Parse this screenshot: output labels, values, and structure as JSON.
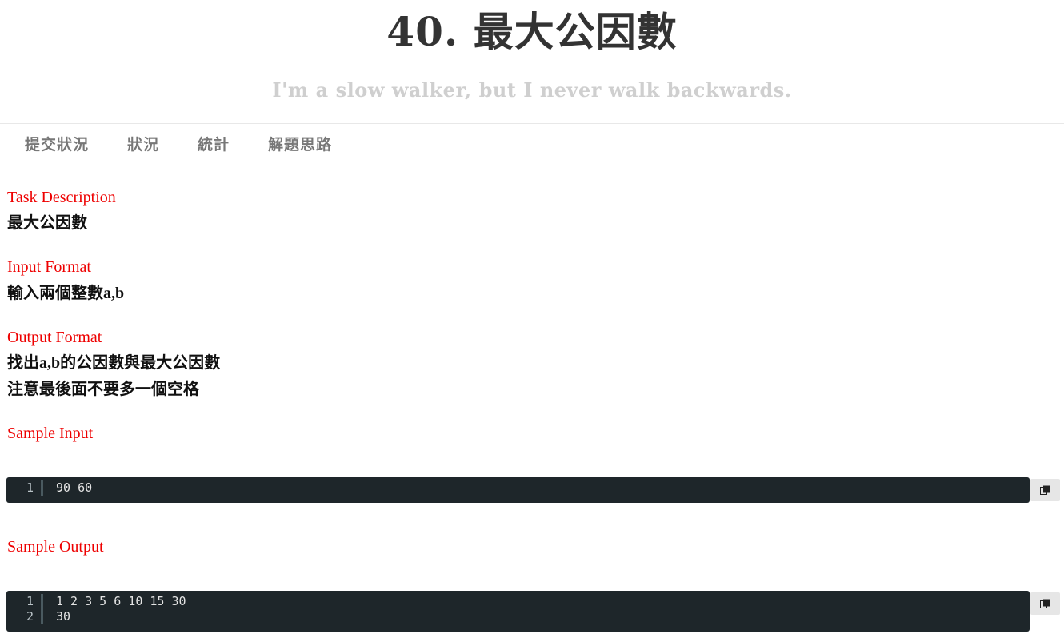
{
  "header": {
    "title": "40. 最大公因數",
    "subtitle": "I'm a slow walker, but I never walk backwards."
  },
  "tabs": [
    {
      "label": "提交狀況"
    },
    {
      "label": "狀況"
    },
    {
      "label": "統計"
    },
    {
      "label": "解題思路"
    }
  ],
  "task": {
    "label": "Task Description",
    "text": "最大公因數"
  },
  "input_format": {
    "label": "Input Format",
    "text": "輸入兩個整數a,b"
  },
  "output_format": {
    "label": "Output Format",
    "lines": [
      "找出a,b的公因數與最大公因數",
      "注意最後面不要多一個空格"
    ]
  },
  "sample_input": {
    "label": "Sample Input",
    "lines": [
      {
        "no": "1",
        "code": "90 60"
      }
    ]
  },
  "sample_output": {
    "label": "Sample Output",
    "lines": [
      {
        "no": "1",
        "code": "1 2 3 5 6 10 15 30"
      },
      {
        "no": "2",
        "code": "30"
      }
    ]
  },
  "colors": {
    "section_label": "#ee0000",
    "code_background": "#1e262a",
    "copy_button": "#e6e6e6"
  },
  "icons": {
    "copy": "copy-icon"
  }
}
